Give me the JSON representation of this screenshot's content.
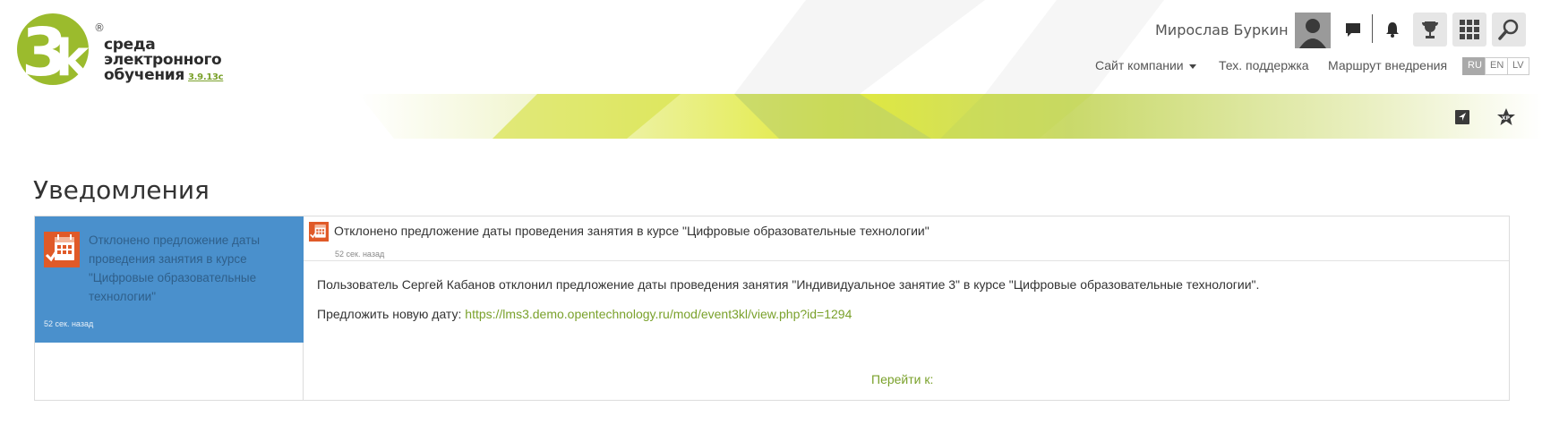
{
  "header": {
    "logo_text_line1": "среда",
    "logo_text_line2": "электронного",
    "logo_text_line3": "обучения",
    "logo_version": "3.9.13c",
    "user_name": "Мирослав Буркин",
    "nav": {
      "company_site": "Сайт компании",
      "tech_support": "Тех. поддержка",
      "route": "Маршрут внедрения"
    },
    "languages": [
      "RU",
      "EN",
      "LV"
    ],
    "active_language": "RU"
  },
  "page_title": "Уведомления",
  "notifications": {
    "list": [
      {
        "title": "Отклонено предложение даты проведения занятия в курсе \"Цифровые образовательные технологии\"",
        "time": "52 сек. назад"
      }
    ],
    "detail": {
      "title": "Отклонено предложение даты проведения занятия в курсе \"Цифровые образовательные технологии\"",
      "time": "52 сек. назад",
      "body": "Пользователь Сергей Кабанов отклонил предложение даты проведения занятия \"Индивидуальное занятие 3\" в курсе \"Цифровые образовательные технологии\".",
      "propose_label": "Предложить новую дату:",
      "propose_link": "https://lms3.demo.opentechnology.ru/mod/event3kl/view.php?id=1294",
      "goto_label": "Перейти к:"
    }
  },
  "colors": {
    "accent_green": "#7aa12b",
    "selected_blue": "#4a90cc",
    "icon_orange": "#e05a28"
  }
}
